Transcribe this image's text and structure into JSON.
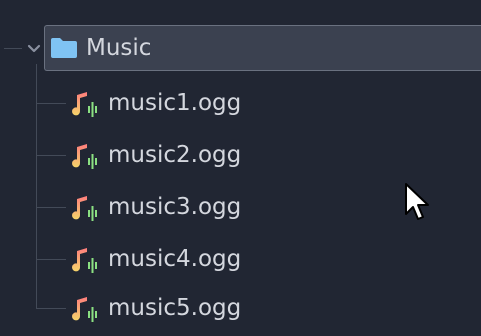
{
  "tree": {
    "folder": {
      "name": "Music",
      "expanded": true,
      "selected": true,
      "icon": "folder-icon"
    },
    "files": [
      {
        "name": "music1.ogg",
        "icon": "audio-file-icon"
      },
      {
        "name": "music2.ogg",
        "icon": "audio-file-icon"
      },
      {
        "name": "music3.ogg",
        "icon": "audio-file-icon"
      },
      {
        "name": "music4.ogg",
        "icon": "audio-file-icon"
      },
      {
        "name": "music5.ogg",
        "icon": "audio-file-icon"
      }
    ]
  },
  "colors": {
    "background": "#212633",
    "selection_fill": "#3b4150",
    "selection_border": "#6a7180",
    "folder_icon": "#7fc3f3",
    "text": "#d4d7de",
    "guide_lines": "#434a58",
    "audio_icon_top": "#ff7d7d",
    "audio_icon_bottom": "#f5d46a",
    "audio_icon_wave": "#8be082"
  }
}
